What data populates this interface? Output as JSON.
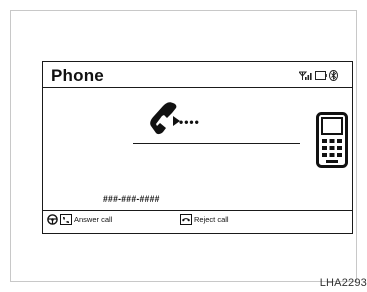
{
  "screen": {
    "title": "Phone",
    "status_icons": [
      "signal-icon",
      "battery-icon",
      "bluetooth-icon"
    ],
    "caller_number": "###-###-####",
    "call_indicator": "incoming-call-icon",
    "device_icon": "mobile-phone-icon"
  },
  "footer": {
    "answer_label": "Answer call",
    "answer_icons": [
      "steering-wheel-icon",
      "phone-answer-icon"
    ],
    "reject_label": "Reject call",
    "reject_icon": "phone-reject-icon"
  },
  "figure_code": "LHA2293"
}
